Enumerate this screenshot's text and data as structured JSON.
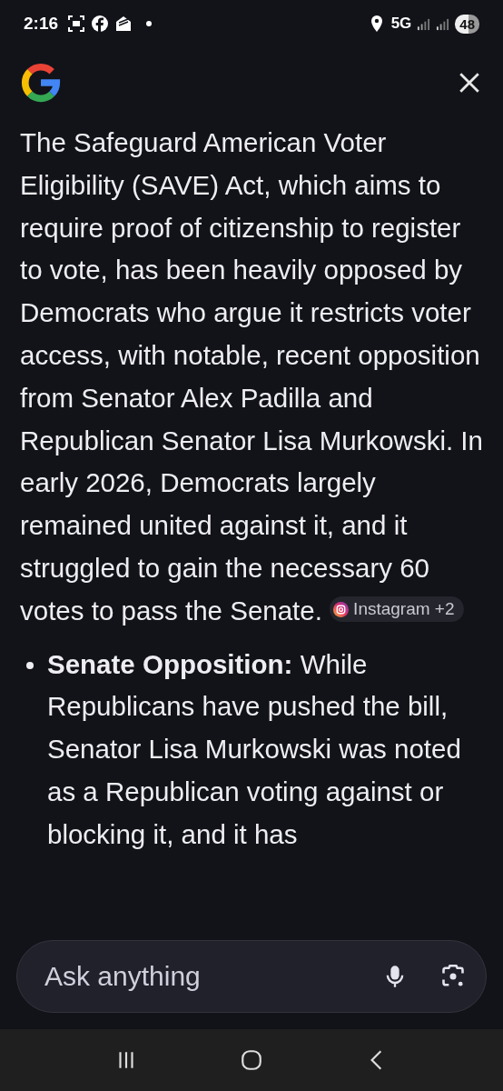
{
  "status_bar": {
    "time": "2:16",
    "network": "5G",
    "battery": "48"
  },
  "answer": {
    "paragraph": "The Safeguard American Voter Eligibility (SAVE) Act, which aims to require proof of citizenship to register to vote, has been heavily opposed by Democrats who argue it restricts voter access, with notable, recent opposition from Senator Alex Padilla and Republican Senator Lisa Murkowski. In early 2026, Democrats largely remained united against it, and it struggled to gain the necessary 60 votes to pass the Senate.",
    "source_chip": "Instagram +2",
    "bullets": [
      "**Senate Opposition:** While Republicans have pushed the bill, Senator Lisa Murkowski was noted as a Republican voting against or blocking it, and it has"
    ]
  },
  "search": {
    "placeholder": "Ask anything"
  }
}
